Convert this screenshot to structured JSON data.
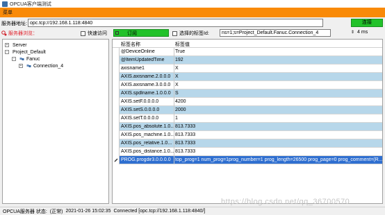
{
  "window": {
    "title": "OPCUA客户端测试"
  },
  "menu": {
    "items": [
      "菜单"
    ]
  },
  "server": {
    "label": "服务器地址:",
    "value": "opc.tcp://192.168.1.118:4840",
    "connect_label": "连接"
  },
  "toolbar": {
    "browse_label": "服务器浏览：",
    "quick_access_label": "快速访问",
    "subscribe_label": "订阅",
    "selected_tag_label": "选择的标签Id:",
    "selected_tag_value": "ns=1;s=Project_Default.Fanuc.Connection_4",
    "interval_value": "4 ms"
  },
  "tree": {
    "nodes": [
      {
        "label": "Server",
        "level": 0,
        "expander": "+"
      },
      {
        "label": "Project_Default",
        "level": 0,
        "expander": "-"
      },
      {
        "label": "Fanuc",
        "level": 1,
        "expander": "-"
      },
      {
        "label": "Connection_4",
        "level": 2,
        "expander": "+"
      }
    ]
  },
  "grid": {
    "columns": [
      "标签名称",
      "标签值"
    ],
    "rows": [
      {
        "name": "@DeviceOnline",
        "value": "True",
        "style": "white"
      },
      {
        "name": "@ItemUpdatedTime",
        "value": "192",
        "style": "alt"
      },
      {
        "name": "axisname1",
        "value": "X",
        "style": "white"
      },
      {
        "name": "AXIS.axisname.2.0.0.0",
        "value": "X",
        "style": "alt"
      },
      {
        "name": "AXIS.axisname.3.0.0.0",
        "value": "X",
        "style": "white"
      },
      {
        "name": "AXIS.spdlname.1.0.0.0",
        "value": "S",
        "style": "alt"
      },
      {
        "name": "AXIS.setF.0.0.0.0",
        "value": "4200",
        "style": "white"
      },
      {
        "name": "AXIS.setS.0.0.0.0",
        "value": "2000",
        "style": "alt"
      },
      {
        "name": "AXIS.setT.0.0.0.0",
        "value": "1",
        "style": "white"
      },
      {
        "name": "AXIS.pos_absolute.1.0...",
        "value": "813.7333",
        "style": "alt"
      },
      {
        "name": "AXIS.pos_machine.1.0...",
        "value": "813.7333",
        "style": "white"
      },
      {
        "name": "AXIS.pos_relative.1.0...",
        "value": "813.7333",
        "style": "alt"
      },
      {
        "name": "AXIS.pos_distance.1.0...",
        "value": "813.7333",
        "style": "white"
      },
      {
        "name": "PROG.progdir3.0.0.0.0",
        "value": "top_prog=1 num_prog=1prog_number=1 prog_length=26500 prog_page=0 prog_comment=(R...",
        "style": "sel"
      }
    ]
  },
  "status": {
    "label": "OPCUA服务器 状态:",
    "state": "(正常)",
    "timestamp": "2021-01-26 15:02:35",
    "message": "Connected [opc.tcp://192.168.1.118:4840/]"
  },
  "watermark": "https://blog.csdn.net/qq_36700570"
}
